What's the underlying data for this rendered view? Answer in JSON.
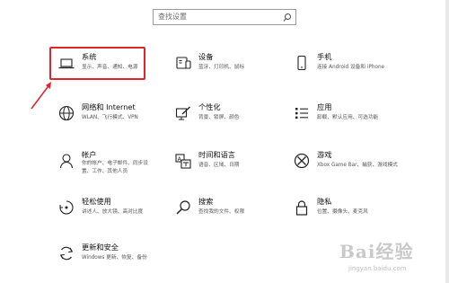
{
  "search": {
    "placeholder": "查找设置"
  },
  "tiles": [
    {
      "title": "系统",
      "desc": "显示、声音、通知、电源"
    },
    {
      "title": "设备",
      "desc": "蓝牙、打印机、鼠标"
    },
    {
      "title": "手机",
      "desc": "连接 Android 设备和 iPhone"
    },
    {
      "title": "网络和 Internet",
      "desc": "WLAN、飞行模式、VPN"
    },
    {
      "title": "个性化",
      "desc": "背景、锁屏、颜色"
    },
    {
      "title": "应用",
      "desc": "卸载、默认应用、可选功能"
    },
    {
      "title": "帐户",
      "desc": "你的帐户、电子邮件、同步设置、工作、其他人员"
    },
    {
      "title": "时间和语言",
      "desc": "语音、区域、日期"
    },
    {
      "title": "游戏",
      "desc": "Xbox Game Bar、捕获、游戏模式"
    },
    {
      "title": "轻松使用",
      "desc": "讲述人、放大镜、高对比度"
    },
    {
      "title": "搜索",
      "desc": "查找我的文件、权限"
    },
    {
      "title": "隐私",
      "desc": "位置、摄像头、麦克风"
    },
    {
      "title": "更新和安全",
      "desc": "Windows 更新、恢复、备份"
    }
  ],
  "watermark": {
    "logo": "Bai经验",
    "site": "jingyan.baidu.com"
  },
  "colors": {
    "accent": "#0063b1",
    "highlight": "#e0242c"
  }
}
